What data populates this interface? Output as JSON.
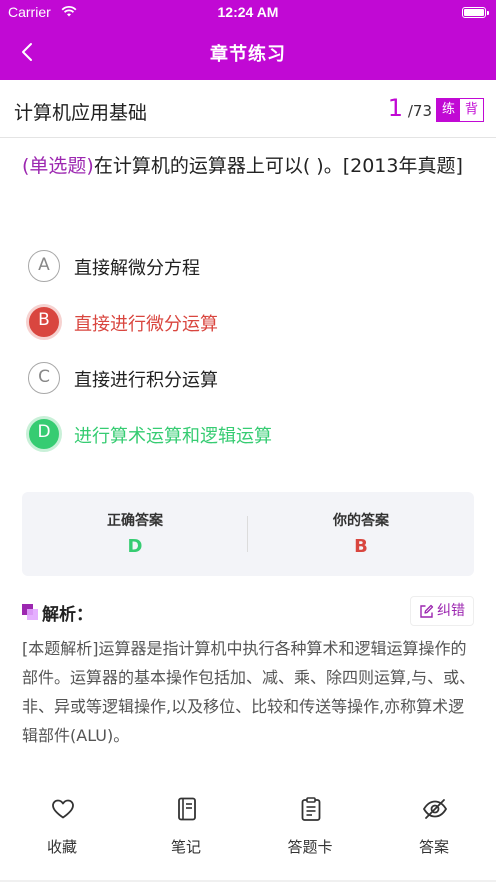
{
  "status": {
    "carrier": "Carrier",
    "time": "12:24 AM"
  },
  "nav": {
    "title": "章节练习"
  },
  "subject": {
    "name": "计算机应用基础",
    "current": "1",
    "total": "/73",
    "mode_practice": "练",
    "mode_recite": "背"
  },
  "question": {
    "type": "(单选题)",
    "text": "在计算机的运算器上可以(      )。[2013年真题]"
  },
  "options": [
    {
      "letter": "A",
      "text": "直接解微分方程",
      "state": "normal"
    },
    {
      "letter": "B",
      "text": "直接进行微分运算",
      "state": "wrong"
    },
    {
      "letter": "C",
      "text": "直接进行积分运算",
      "state": "normal"
    },
    {
      "letter": "D",
      "text": "进行算术运算和逻辑运算",
      "state": "right"
    }
  ],
  "answer": {
    "correct_label": "正确答案",
    "correct_value": "D",
    "yours_label": "你的答案",
    "yours_value": "B"
  },
  "analysis": {
    "title": "解析：",
    "correct_button": "纠错",
    "body": "[本题解析]运算器是指计算机中执行各种算术和逻辑运算操作的部件。运算器的基本操作包括加、减、乘、除四则运算,与、或、非、异或等逻辑操作,以及移位、比较和传送等操作,亦称算术逻辑部件(ALU)。"
  },
  "tabs": [
    {
      "label": "收藏",
      "icon": "heart-icon"
    },
    {
      "label": "笔记",
      "icon": "notebook-icon"
    },
    {
      "label": "答题卡",
      "icon": "answer-card-icon"
    },
    {
      "label": "答案",
      "icon": "eye-off-icon"
    }
  ],
  "colors": {
    "brand": "#c109d4",
    "wrong": "#d9463f",
    "right": "#36cc72"
  }
}
